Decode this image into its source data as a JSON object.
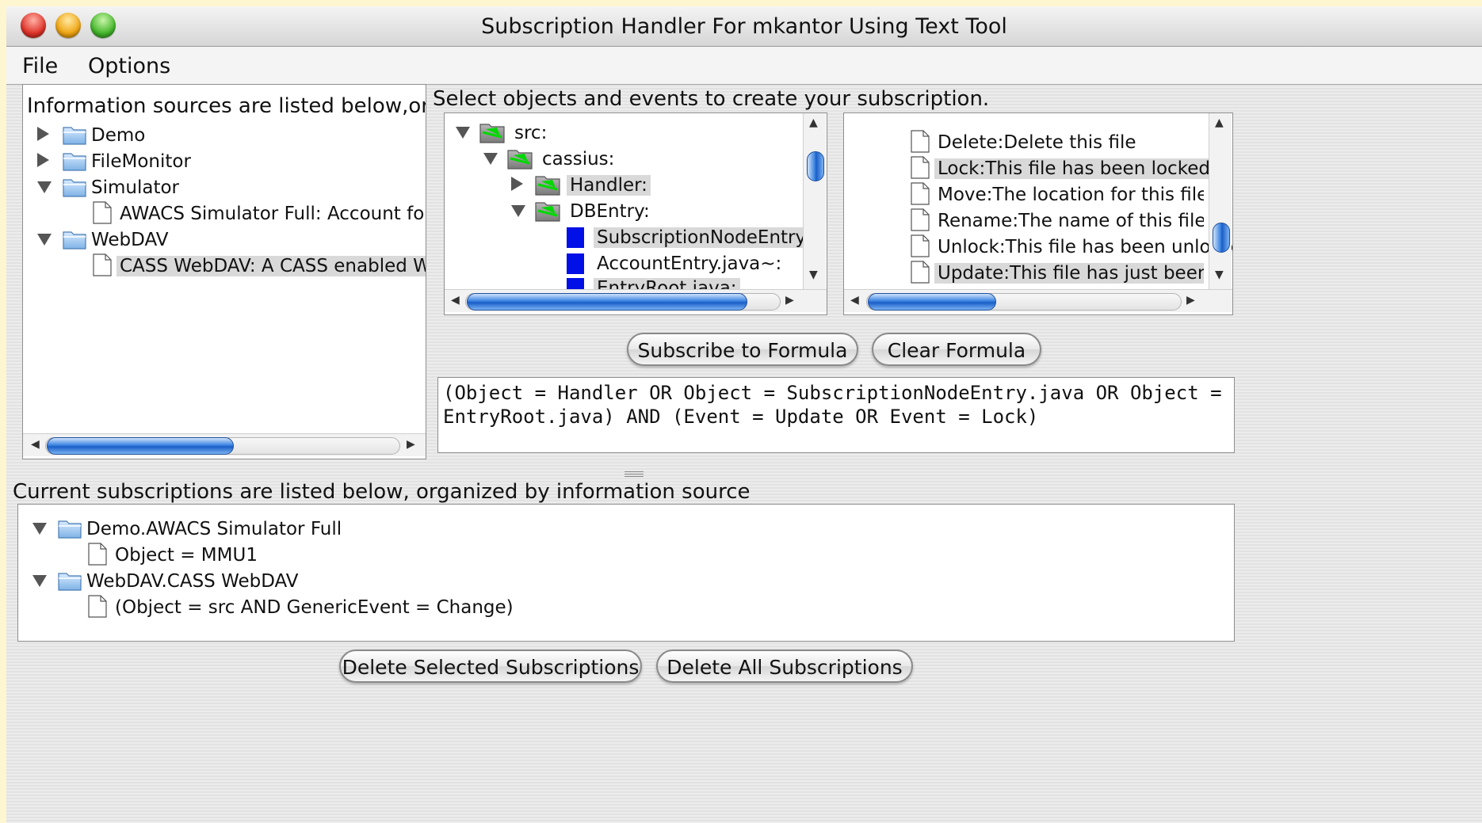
{
  "window": {
    "title": "Subscription Handler For mkantor Using Text Tool"
  },
  "menu": [
    "File",
    "Options"
  ],
  "sources_panel": {
    "label": "Information sources are listed below,organiz",
    "items": [
      {
        "label": "Demo",
        "expanded": false,
        "kind": "folder"
      },
      {
        "label": "FileMonitor",
        "expanded": false,
        "kind": "folder"
      },
      {
        "label": "Simulator",
        "expanded": true,
        "kind": "folder"
      },
      {
        "label": "AWACS Simulator Full: Account for storir",
        "kind": "file"
      },
      {
        "label": "WebDAV",
        "expanded": true,
        "kind": "folder"
      },
      {
        "label": "CASS WebDAV: A CASS enabled WebDAV",
        "kind": "file",
        "selected": true
      }
    ]
  },
  "select_label": "Select objects and events to create your subscription.",
  "objects_tree": {
    "items": [
      {
        "label": "src:"
      },
      {
        "label": "cassius:"
      },
      {
        "label": "Handler:",
        "selected": true
      },
      {
        "label": "DBEntry:"
      },
      {
        "label": "SubscriptionNodeEntry.java",
        "selected": true
      },
      {
        "label": "AccountEntry.java~:"
      },
      {
        "label": "EntryRoot.java:",
        "selected": true
      }
    ]
  },
  "events_list": {
    "items": [
      {
        "label": "Delete:Delete this file"
      },
      {
        "label": "Lock:This file has been locked",
        "selected": true
      },
      {
        "label": "Move:The location for this file has c"
      },
      {
        "label": "Rename:The name of this file has ch"
      },
      {
        "label": "Unlock:This file has been unlocked"
      },
      {
        "label": "Update:This file has just been modif",
        "selected": true
      }
    ]
  },
  "buttons": {
    "subscribe": "Subscribe to Formula",
    "clear": "Clear Formula",
    "delete_selected": "Delete Selected Subscriptions",
    "delete_all": "Delete All Subscriptions"
  },
  "formula": "(Object = Handler OR Object = SubscriptionNodeEntry.java OR Object = EntryRoot.java) AND (Event = Update OR Event = Lock)",
  "subscriptions_panel": {
    "label": "Current subscriptions are listed below, organized by information source",
    "items": [
      {
        "label": "Demo.AWACS Simulator Full",
        "kind": "folder"
      },
      {
        "label": "Object = MMU1",
        "kind": "file"
      },
      {
        "label": "WebDAV.CASS WebDAV",
        "kind": "folder"
      },
      {
        "label": "(Object = src AND GenericEvent = Change)",
        "kind": "file"
      }
    ]
  },
  "colors": {
    "accent": "#1a5ec8",
    "selection": "#d9d9d9",
    "object_marker": "#0010e6",
    "folder_green": "#00c800"
  }
}
